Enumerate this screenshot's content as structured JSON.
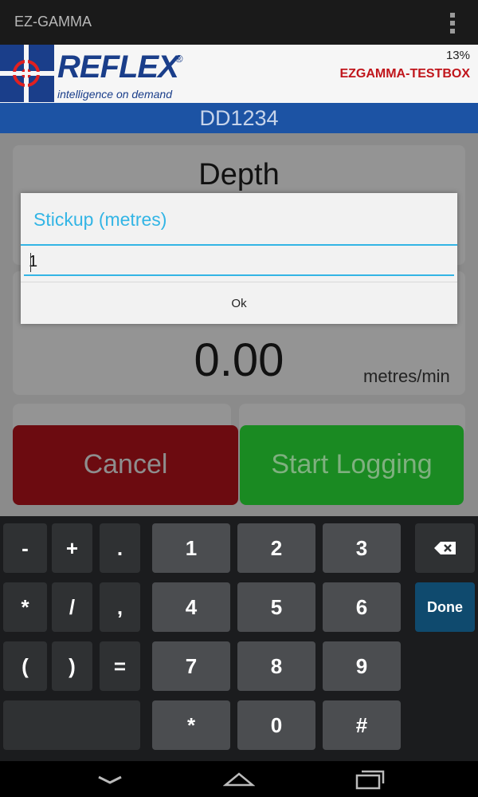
{
  "action_bar": {
    "title": "EZ-GAMMA",
    "overflow_icon": "overflow-menu-icon"
  },
  "header": {
    "brand": "REFLEX",
    "registered_mark": "®",
    "tagline": "intelligence on demand",
    "battery": "13%",
    "device_name": "EZGAMMA-TESTBOX",
    "hole_id": "DD1234"
  },
  "main": {
    "depth_label": "Depth",
    "speed_value": "0.00",
    "speed_units": "metres/min",
    "cancel_label": "Cancel",
    "start_label": "Start Logging"
  },
  "dialog": {
    "title": "Stickup (metres)",
    "input_value": "1",
    "ok_label": "Ok"
  },
  "keyboard": {
    "sym_keys": [
      "-",
      "+",
      ".",
      "*",
      "/",
      ",",
      "(",
      ")",
      "="
    ],
    "num_keys": [
      "1",
      "2",
      "3",
      "4",
      "5",
      "6",
      "7",
      "8",
      "9",
      "*",
      "0",
      "#"
    ],
    "done_label": "Done",
    "backspace_icon": "backspace-icon"
  },
  "colors": {
    "accent": "#33b5e5",
    "brand_blue": "#1c53a4",
    "device_red": "#c0151b",
    "cancel_red": "#6c0b10",
    "start_green": "#1a8a22"
  }
}
